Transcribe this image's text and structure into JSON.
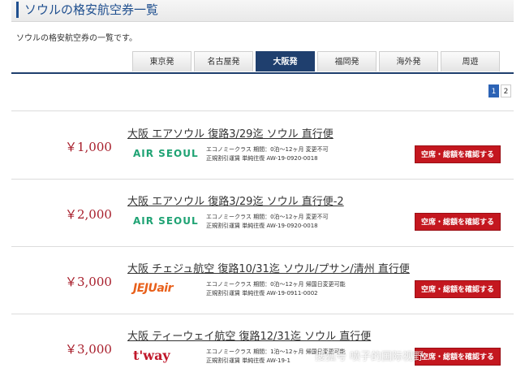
{
  "header": {
    "title": "ソウルの格安航空券一覧"
  },
  "subtitle": "ソウルの格安航空券の一覧です。",
  "tabs": [
    {
      "label": "東京発",
      "active": false
    },
    {
      "label": "名古屋発",
      "active": false
    },
    {
      "label": "大阪発",
      "active": true
    },
    {
      "label": "福岡発",
      "active": false
    },
    {
      "label": "海外発",
      "active": false
    },
    {
      "label": "周遊",
      "active": false
    }
  ],
  "pager": {
    "pages": [
      "1",
      "2"
    ],
    "current": "1"
  },
  "items": [
    {
      "price": "￥1,000",
      "title": "大阪 エアソウル 復路3/29迄 ソウル 直行便",
      "logo": "AIR SEOUL",
      "line1": "エコノミークラス 期間：0泊～12ヶ月 変更不可",
      "line2": "正規割引運賃 単純往復 AW-19-0920-0018",
      "button": "空席・総額を確認する"
    },
    {
      "price": "￥2,000",
      "title": "大阪 エアソウル 復路3/29迄 ソウル 直行便-2",
      "logo": "AIR SEOUL",
      "line1": "エコノミークラス 期間：0泊～12ヶ月 変更不可",
      "line2": "正規割引運賃 単純往復 AW-19-0920-0018",
      "button": "空席・総額を確認する"
    },
    {
      "price": "￥3,000",
      "title": "大阪 チェジュ航空 復路10/31迄 ソウル/プサン/清州 直行便",
      "logo": "JEJUair",
      "line1": "エコノミークラス 期間：0泊～12ヶ月 帰国日変更可能",
      "line2": "正規割引運賃 単純往復 AW-19-0911-0002",
      "button": "空席・総額を確認する"
    },
    {
      "price": "￥3,000",
      "title": "大阪 ティーウェイ航空 復路12/31迄 ソウル 直行便",
      "logo": "t'way",
      "line1": "エコノミークラス 期間：1泊～12ヶ月 帰国日変更可能",
      "line2": "正規割引運賃 単純往復 AW-19-1",
      "button": "空席・総額を確認する"
    }
  ],
  "watermark": "搜狐号 喷子的国际视野"
}
